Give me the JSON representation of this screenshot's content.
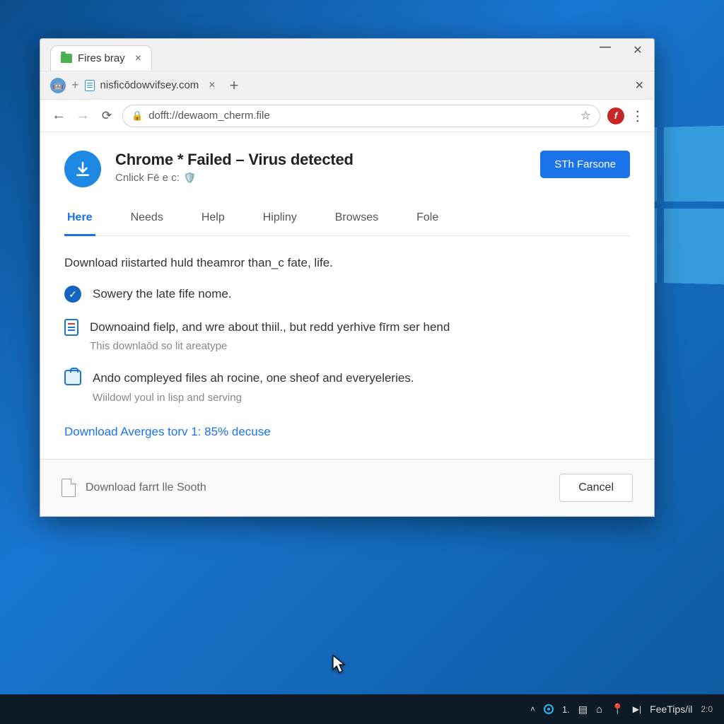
{
  "tabs": {
    "tab1_label": "Fires bray",
    "tab2_label": "nisficōdowvifsey.com"
  },
  "address_bar": {
    "url": "dofft://dewaom_cherm.file"
  },
  "page": {
    "title": "Chrome * Failed – Virus detected",
    "subtitle": "Cnlick Fē e c:",
    "primary_button": "STh Farsone"
  },
  "nav_tabs": {
    "t0": "Here",
    "t1": "Needs",
    "t2": "Help",
    "t3": "Hipliny",
    "t4": "Browses",
    "t5": "Fole"
  },
  "body": {
    "intro": "Download riistarted huld theamror than_c fate, life.",
    "item1": "Sowery the late fife nome.",
    "item2_main": "Downoaind fielp, and wre about thiil., but redd yerhive fīrm ser hend",
    "item2_sub": "This downlaōd so lit areatype",
    "item3_main": "Ando compleyed files ah rocine, one sheof and everyeleries.",
    "item3_sub": "Wiildowl youl in lisp and serving",
    "progress_link": "Download Averges torv 1: 85% decuse"
  },
  "footer": {
    "file_label": "Download farrt lle Sooth",
    "cancel": "Cancel"
  },
  "taskbar": {
    "num": "1.",
    "tips": "FeeTips/il",
    "time": "2:0"
  }
}
